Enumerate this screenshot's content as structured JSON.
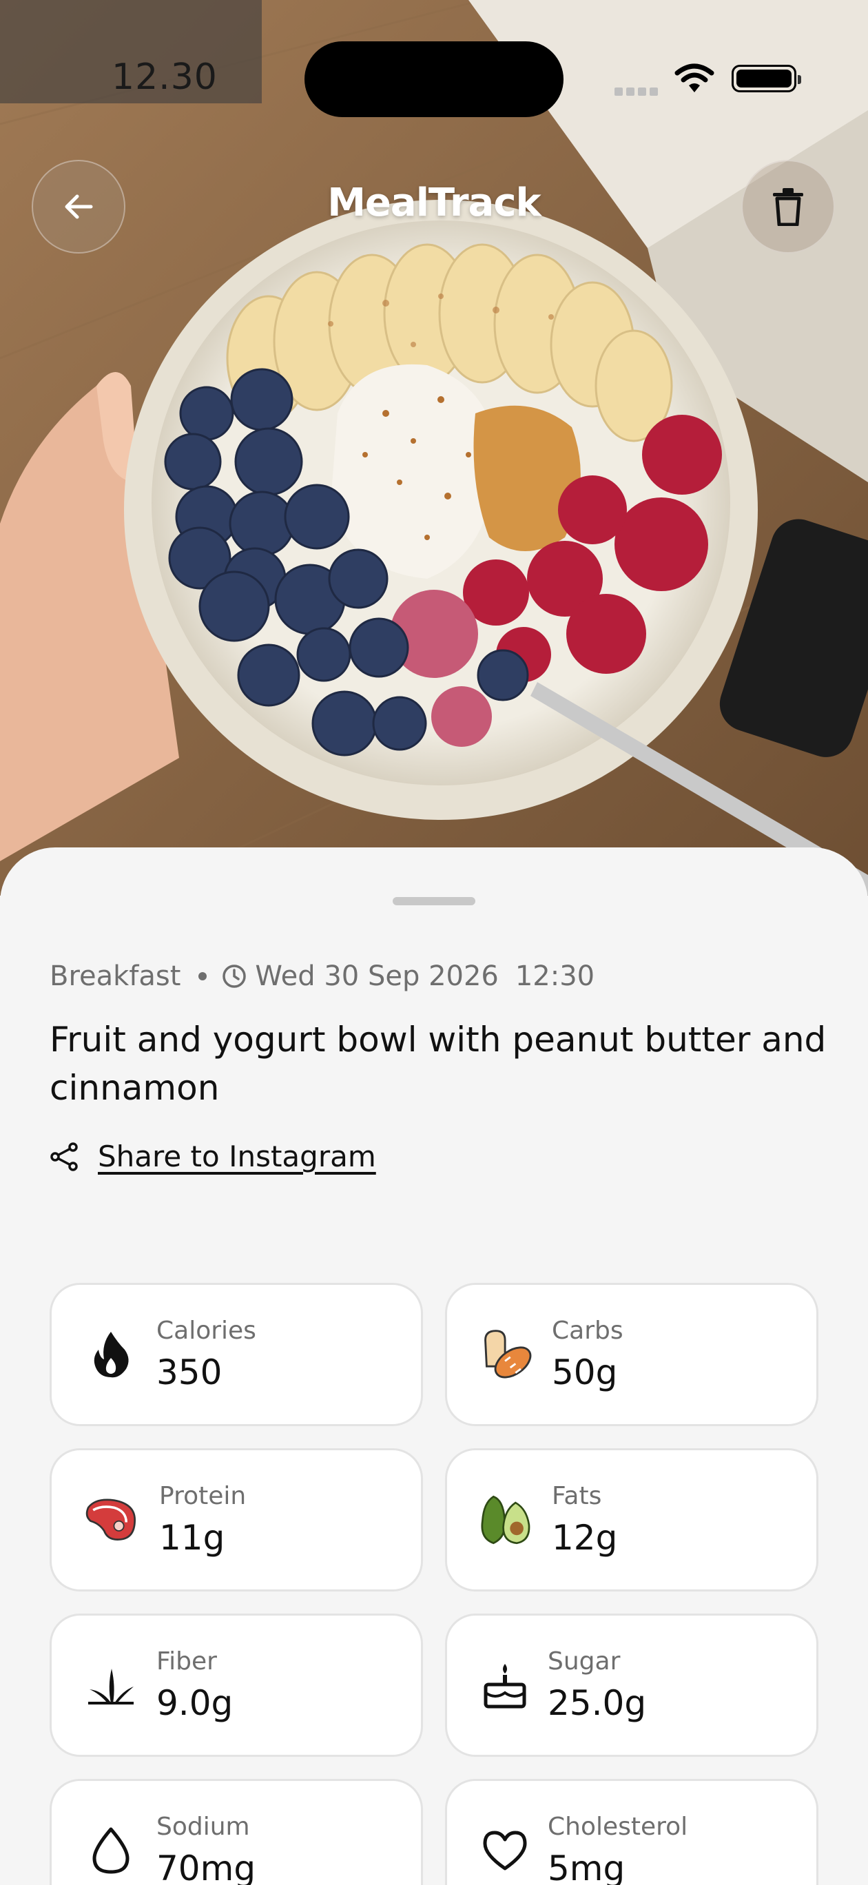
{
  "status_bar": {
    "time": "12.30"
  },
  "header": {
    "title": "MealTrack"
  },
  "meal": {
    "type": "Breakfast",
    "date": "Wed 30 Sep 2026",
    "time": "12:30",
    "title": "Fruit and yogurt bowl with peanut butter and cinnamon"
  },
  "share": {
    "label": "Share to Instagram"
  },
  "nutrition": [
    {
      "label": "Calories",
      "value": "350",
      "icon": "fire-icon"
    },
    {
      "label": "Carbs",
      "value": "50g",
      "icon": "bread-icon"
    },
    {
      "label": "Protein",
      "value": "11g",
      "icon": "steak-icon"
    },
    {
      "label": "Fats",
      "value": "12g",
      "icon": "avocado-icon"
    },
    {
      "label": "Fiber",
      "value": "9.0g",
      "icon": "grass-icon"
    },
    {
      "label": "Sugar",
      "value": "25.0g",
      "icon": "cake-icon"
    },
    {
      "label": "Sodium",
      "value": "70mg",
      "icon": "drop-icon"
    },
    {
      "label": "Cholesterol",
      "value": "5mg",
      "icon": "heart-icon"
    }
  ]
}
